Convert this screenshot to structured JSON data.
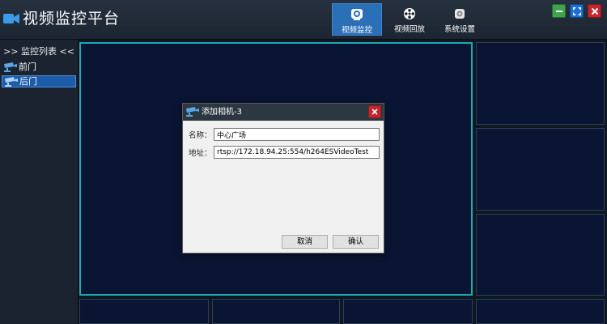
{
  "app": {
    "title": "视频监控平台"
  },
  "nav": {
    "tabs": [
      {
        "label": "视频监控",
        "icon": "camera-icon",
        "active": true
      },
      {
        "label": "视频回放",
        "icon": "film-reel-icon",
        "active": false
      },
      {
        "label": "系统设置",
        "icon": "gear-icon",
        "active": false
      }
    ]
  },
  "window_controls": {
    "minimize": {
      "icon": "minimize-icon",
      "color": "#3fa34d"
    },
    "maximize": {
      "icon": "maximize-icon",
      "color": "#1b6fd6"
    },
    "close": {
      "icon": "close-icon",
      "color": "#c8262c"
    }
  },
  "sidebar": {
    "header": ">> 监控列表 <<",
    "items": [
      {
        "label": "前门",
        "icon": "cctv-camera-icon",
        "selected": false
      },
      {
        "label": "后门",
        "icon": "cctv-camera-icon",
        "selected": true
      }
    ]
  },
  "dialog": {
    "title": "添加相机-3",
    "icon": "cctv-camera-icon",
    "fields": [
      {
        "label": "名称：",
        "value": "中心广场"
      },
      {
        "label": "地址：",
        "value": "rtsp://172.18.94.25:554/h264ESVideoTest"
      }
    ],
    "buttons": {
      "cancel": "取消",
      "ok": "确认"
    }
  },
  "colors": {
    "accent": "#2b6fb7",
    "selected_cell_border": "#1ea7b3",
    "video_bg": "#091532"
  }
}
